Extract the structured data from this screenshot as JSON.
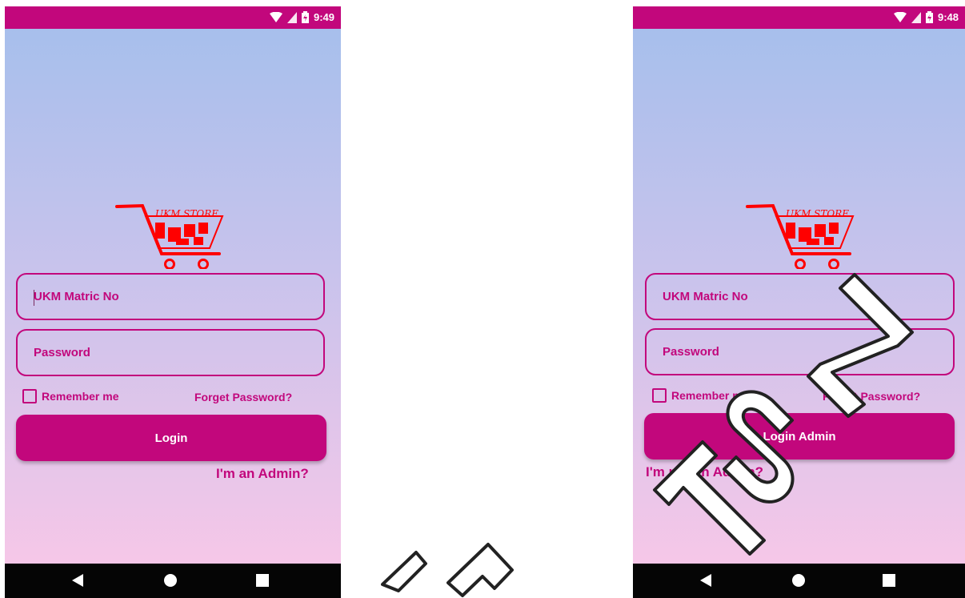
{
  "screens": [
    {
      "status": {
        "time": "9:49"
      },
      "fields": {
        "matric_placeholder": "UKM Matric No",
        "password_placeholder": "Password"
      },
      "remember_label": "Remember me",
      "forget_label": "Forget Password?",
      "login_label": "Login",
      "admin_link": "I'm an Admin?"
    },
    {
      "status": {
        "time": "9:48"
      },
      "fields": {
        "matric_placeholder": "UKM Matric No",
        "password_placeholder": "Password"
      },
      "remember_label": "Remember me",
      "forget_label": "Forget Password?",
      "login_label": "Login Admin",
      "admin_link": "I'm not an Admin?"
    }
  ],
  "logo": {
    "text": "UKM STORE",
    "color": "#ff0000"
  },
  "watermark": "UTM",
  "colors": {
    "accent": "#c2077c",
    "nav": "#050505"
  },
  "icons": [
    "wifi-icon",
    "signal-icon",
    "battery-icon",
    "back-icon",
    "home-icon",
    "recents-icon"
  ]
}
